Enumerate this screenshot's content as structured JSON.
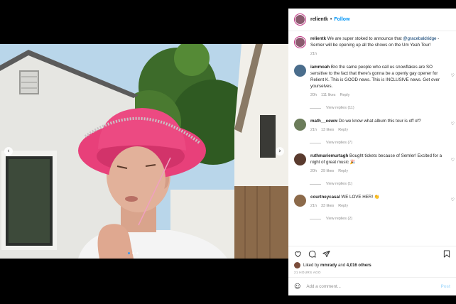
{
  "post": {
    "author": "relientk",
    "follow_label": "Follow",
    "dot": "•",
    "caption_user": "relientk",
    "caption_text_1": "We are super stoked to announce that ",
    "caption_mention": "@gracebaldridge",
    "caption_text_2": " - Semler will be opening up all the shows on the Um Yeah Tour!",
    "caption_time": "21h"
  },
  "comments": [
    {
      "user": "iammoah",
      "text": "Bro the same people who call us snowflakes are SO sensitive to the fact that there's gonna be a openly gay opener for Relient K. This is GOOD news. This is INCLUSIVE news. Get over yourselves.",
      "time": "20h",
      "likes": "111 likes",
      "reply": "Reply",
      "view_replies": "View replies (11)",
      "avatar_color": "#4a6d8c"
    },
    {
      "user": "math__eeww",
      "text": "Do we know what album this tour is off of?",
      "time": "21h",
      "likes": "13 likes",
      "reply": "Reply",
      "view_replies": "View replies (7)",
      "avatar_color": "#6b7c5a"
    },
    {
      "user": "ruthmariemurtagh",
      "text": "Bought tickets because of Semler! Excited for a night of great music 🎉",
      "time": "20h",
      "likes": "29 likes",
      "reply": "Reply",
      "view_replies": "View replies (1)",
      "avatar_color": "#5a3b2e"
    },
    {
      "user": "courtneycasal",
      "text": "WE LOVE HER! 👏",
      "time": "21h",
      "likes": "33 likes",
      "reply": "Reply",
      "view_replies": "View replies (2)",
      "avatar_color": "#8c6a4a"
    }
  ],
  "likes": {
    "prefix": "Liked by ",
    "user": "mmrady",
    "mid": " and ",
    "count": "4,016 others"
  },
  "time_ago": "21 HOURS AGO",
  "add_comment": {
    "placeholder": "Add a comment...",
    "post_label": "Post"
  },
  "icons": {
    "smile": "☺",
    "heart": "♡",
    "prev": "‹",
    "next": "›"
  },
  "colors": {
    "link": "#0095f6",
    "hat": "#e8407a"
  }
}
